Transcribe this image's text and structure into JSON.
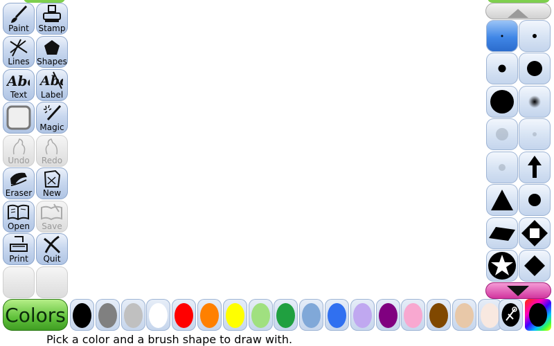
{
  "tools": [
    {
      "label": "Paint",
      "icon": "paintbrush-icon",
      "state": "active"
    },
    {
      "label": "Stamp",
      "icon": "stamp-icon",
      "state": "normal"
    },
    {
      "label": "Lines",
      "icon": "lines-icon",
      "state": "normal"
    },
    {
      "label": "Shapes",
      "icon": "pentagon-icon",
      "state": "normal"
    },
    {
      "label": "Text",
      "icon": "text-abc-icon",
      "state": "normal"
    },
    {
      "label": "Label",
      "icon": "label-abc-icon",
      "state": "normal"
    },
    {
      "label": "",
      "icon": "fill-square-icon",
      "state": "normal"
    },
    {
      "label": "Magic",
      "icon": "magic-wand-icon",
      "state": "normal"
    },
    {
      "label": "Undo",
      "icon": "undo-icon",
      "state": "disabled"
    },
    {
      "label": "Redo",
      "icon": "redo-icon",
      "state": "disabled"
    },
    {
      "label": "Eraser",
      "icon": "eraser-icon",
      "state": "normal"
    },
    {
      "label": "New",
      "icon": "new-page-icon",
      "state": "normal"
    },
    {
      "label": "Open",
      "icon": "open-book-icon",
      "state": "normal"
    },
    {
      "label": "Save",
      "icon": "save-icon",
      "state": "disabled"
    },
    {
      "label": "Print",
      "icon": "printer-icon",
      "state": "normal"
    },
    {
      "label": "Quit",
      "icon": "quit-x-icon",
      "state": "normal"
    }
  ],
  "brushes": [
    {
      "icon": "brush-tiny-dot-icon"
    },
    {
      "icon": "brush-small-dot-icon"
    },
    {
      "icon": "brush-medium-dot-icon"
    },
    {
      "icon": "brush-large-dot-icon"
    },
    {
      "icon": "brush-xlarge-dot-icon"
    },
    {
      "icon": "brush-fuzzy-dot-icon"
    },
    {
      "icon": "brush-faint-dot-icon"
    },
    {
      "icon": "brush-faint-small-dot-icon"
    },
    {
      "icon": "brush-faint-tiny-dot-icon"
    },
    {
      "icon": "brush-arrow-up-icon"
    },
    {
      "icon": "brush-triangle-icon"
    },
    {
      "icon": "brush-round-icon"
    },
    {
      "icon": "brush-parallelogram-icon"
    },
    {
      "icon": "brush-diamond-square-icon"
    },
    {
      "icon": "brush-star-icon"
    },
    {
      "icon": "brush-diamond-icon"
    }
  ],
  "colors_label": "Colors",
  "palette": [
    "#000000",
    "#808080",
    "#c0c0c0",
    "#ffffff",
    "#ff0000",
    "#ff8000",
    "#ffff00",
    "#a0e080",
    "#20a040",
    "#80a8d8",
    "#3070f0",
    "#c0a8f0",
    "#800080",
    "#f8a8d0",
    "#804800",
    "#e8c8a8",
    "#f8e8e0"
  ],
  "palette_extra": [
    "color-picker-icon",
    "rainbow-color-icon"
  ],
  "status_text": "Pick a color and a brush shape to draw with."
}
